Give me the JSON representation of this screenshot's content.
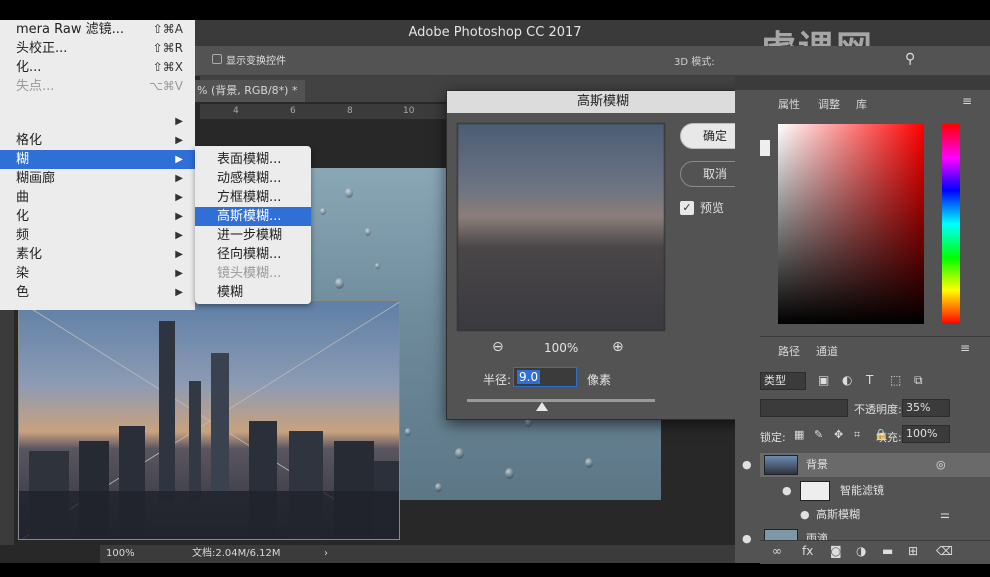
{
  "window": {
    "title": "Adobe Photoshop CC 2017"
  },
  "watermark": {
    "text": "虎课网"
  },
  "options_bar": {
    "show_transform_controls": "显示变换控件",
    "mode_3d": "3D 模式:"
  },
  "doc_tab": {
    "label": "% (背景, RGB/8*) *"
  },
  "ruler": {
    "ticks": [
      "4",
      "6",
      "8",
      "10"
    ]
  },
  "filter_menu": {
    "items": [
      {
        "label": "mera Raw 滤镜...",
        "shortcut": "⇧⌘A",
        "disabled": false
      },
      {
        "label": "头校正...",
        "shortcut": "⇧⌘R",
        "disabled": false
      },
      {
        "label": "化...",
        "shortcut": "⇧⌘X",
        "disabled": false
      },
      {
        "label": "失点...",
        "shortcut": "⌥⌘V",
        "disabled": true
      },
      {
        "label": "",
        "arrow": "▶"
      },
      {
        "label": "格化",
        "arrow": "▶"
      },
      {
        "label": "糊",
        "arrow": "▶",
        "highlighted": true
      },
      {
        "label": "糊画廊",
        "arrow": "▶"
      },
      {
        "label": "曲",
        "arrow": "▶"
      },
      {
        "label": "化",
        "arrow": "▶"
      },
      {
        "label": "频",
        "arrow": "▶"
      },
      {
        "label": "素化",
        "arrow": "▶"
      },
      {
        "label": "染",
        "arrow": "▶"
      },
      {
        "label": "色",
        "arrow": "▶"
      }
    ]
  },
  "blur_submenu": {
    "items": [
      {
        "label": "表面模糊...",
        "highlighted": false,
        "disabled": false
      },
      {
        "label": "动感模糊...",
        "highlighted": false,
        "disabled": false
      },
      {
        "label": "方框模糊...",
        "highlighted": false,
        "disabled": false
      },
      {
        "label": "高斯模糊...",
        "highlighted": true,
        "disabled": false
      },
      {
        "label": "进一步模糊",
        "highlighted": false,
        "disabled": false
      },
      {
        "label": "径向模糊...",
        "highlighted": false,
        "disabled": false
      },
      {
        "label": "镜头模糊...",
        "highlighted": false,
        "disabled": true
      },
      {
        "label": "模糊",
        "highlighted": false,
        "disabled": false
      }
    ]
  },
  "gaussian_dialog": {
    "title": "高斯模糊",
    "ok_label": "确定",
    "cancel_label": "取消",
    "preview_label": "预览",
    "preview_checked": true,
    "zoom_level": "100%",
    "radius_label": "半径:",
    "radius_value": "9.0",
    "radius_unit": "像素",
    "slider_fraction": 0.4
  },
  "status_bar": {
    "zoom": "100%",
    "doc_info": "文档:2.04M/6.12M"
  },
  "right_panel": {
    "color_tabs": [
      "属性",
      "调整",
      "库"
    ],
    "layers_tabs": [
      "路径",
      "通道"
    ],
    "filter_kind": "类型",
    "blend_mode": "",
    "opacity_label": "不透明度:",
    "opacity_value": "35%",
    "lock_label": "锁定:",
    "fill_label": "填充:",
    "fill_value": "100%",
    "layers": [
      {
        "name": "背景",
        "kind": "smart-object"
      },
      {
        "name": "智能滤镜",
        "kind": "smart-filters"
      },
      {
        "name": "高斯模糊",
        "kind": "filter"
      },
      {
        "name": "雨滴",
        "kind": "layer"
      }
    ]
  }
}
